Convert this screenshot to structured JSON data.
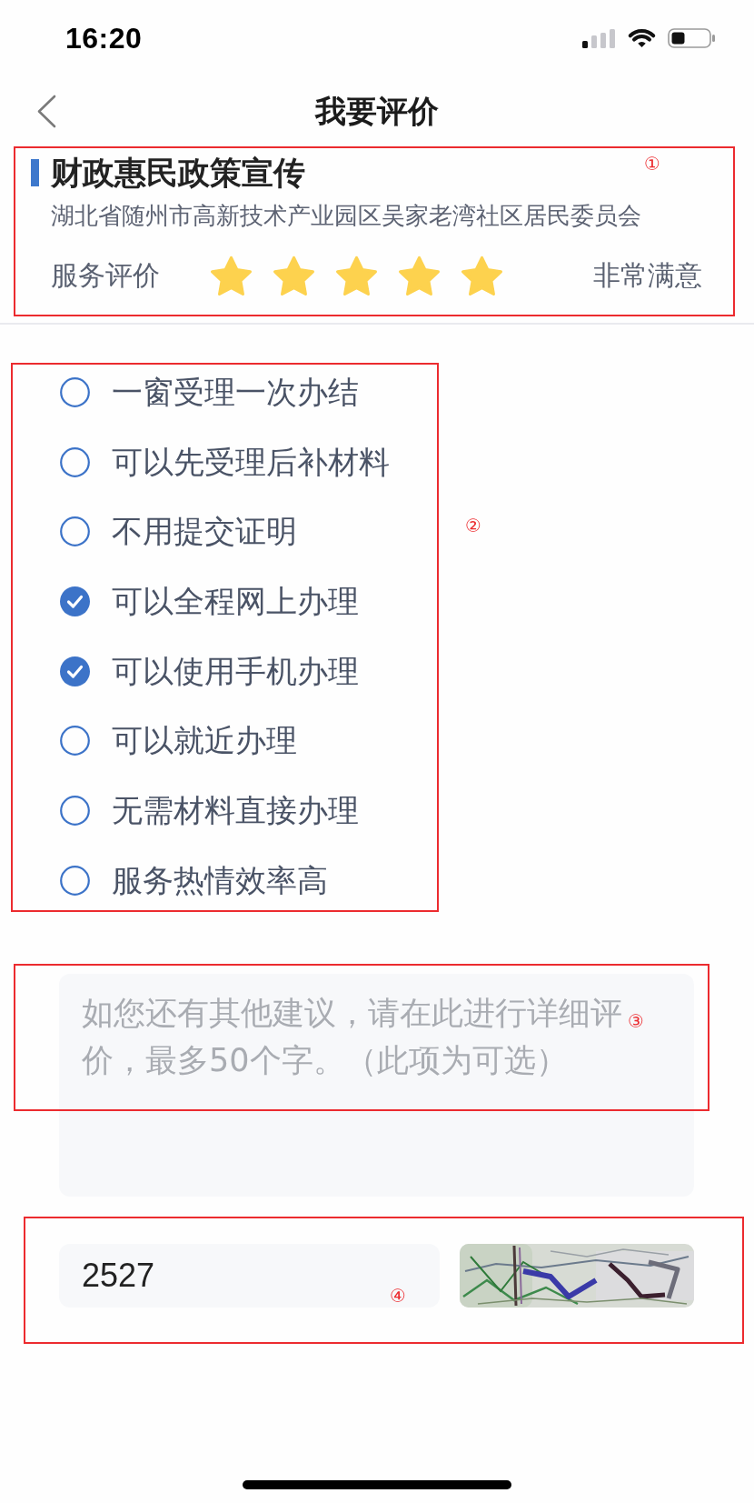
{
  "status_bar": {
    "time": "16:20"
  },
  "nav": {
    "title": "我要评价"
  },
  "service": {
    "title": "财政惠民政策宣传",
    "organization": "湖北省随州市高新技术产业园区吴家老湾社区居民委员会",
    "rating": {
      "label": "服务评价",
      "stars": 5,
      "verdict": "非常满意"
    }
  },
  "options": [
    {
      "label": "一窗受理一次办结",
      "checked": false
    },
    {
      "label": "可以先受理后补材料",
      "checked": false
    },
    {
      "label": "不用提交证明",
      "checked": false
    },
    {
      "label": "可以全程网上办理",
      "checked": true
    },
    {
      "label": "可以使用手机办理",
      "checked": true
    },
    {
      "label": "可以就近办理",
      "checked": false
    },
    {
      "label": "无需材料直接办理",
      "checked": false
    },
    {
      "label": "服务热情效率高",
      "checked": false
    }
  ],
  "comment": {
    "placeholder": "如您还有其他建议，请在此进行详细评价，最多50个字。（此项为可选）"
  },
  "captcha": {
    "value": "2527"
  },
  "annotations": [
    {
      "label": "①"
    },
    {
      "label": "②"
    },
    {
      "label": "③"
    },
    {
      "label": "④"
    }
  ]
}
